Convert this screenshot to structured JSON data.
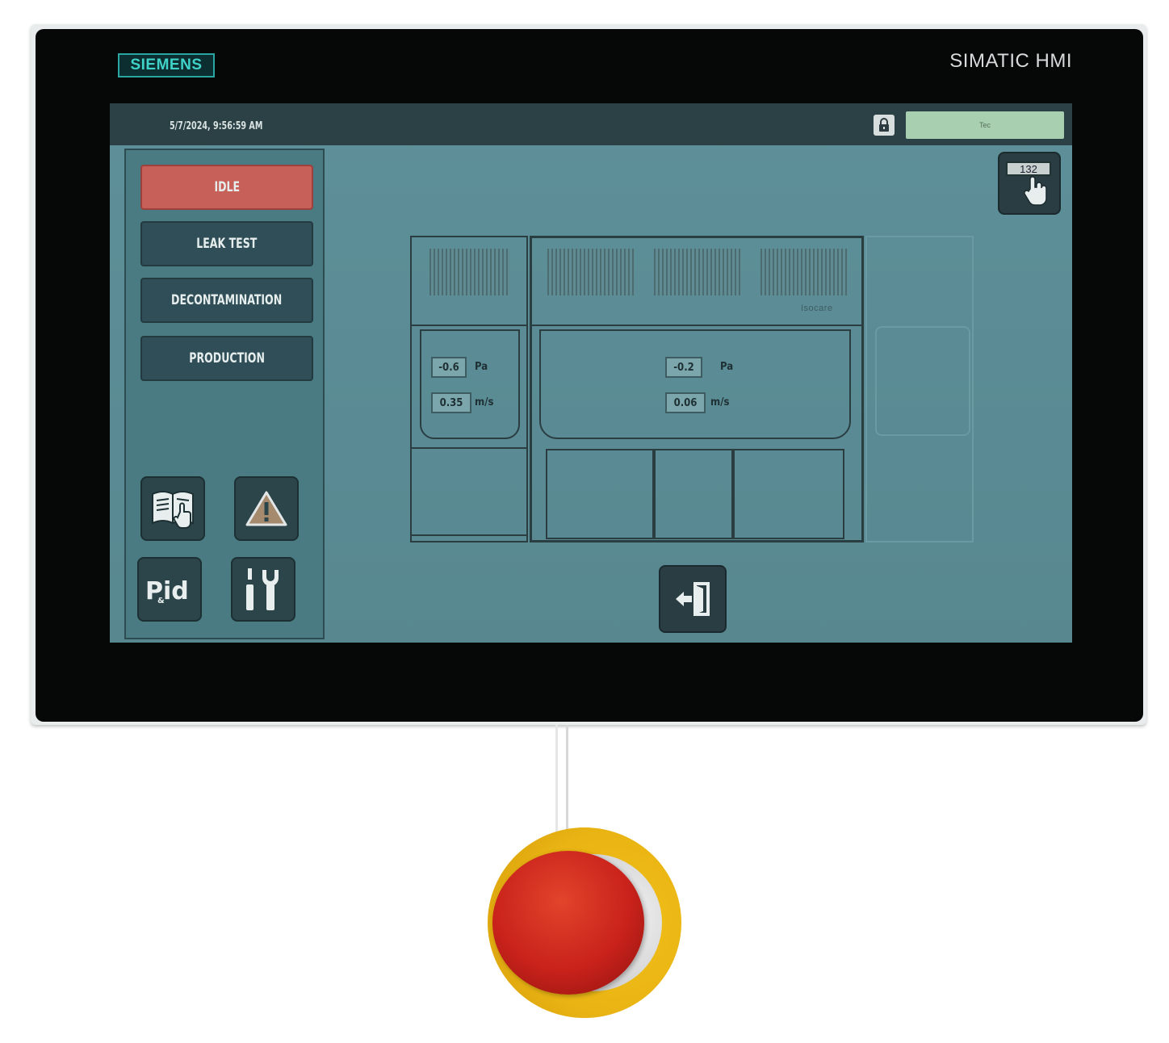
{
  "device": {
    "brand": "SIEMENS",
    "model": "SIMATIC HMI"
  },
  "topbar": {
    "datetime": "5/7/2024, 9:56:59 AM",
    "user": "Tec"
  },
  "sidebar": {
    "modes": [
      {
        "label": "IDLE",
        "active": true
      },
      {
        "label": "LEAK TEST",
        "active": false
      },
      {
        "label": "DECONTAMINATION",
        "active": false
      },
      {
        "label": "PRODUCTION",
        "active": false
      }
    ],
    "tools": [
      "manual-icon",
      "warning-icon",
      "pid-icon",
      "tools-icon"
    ],
    "pid_label": "Pid",
    "pid_sub": "&"
  },
  "keypad": {
    "display": "132"
  },
  "diagram": {
    "brand_mark": "Isocare",
    "left_chamber": {
      "pressure": "-0.6",
      "pressure_unit": "Pa",
      "airflow": "0.35",
      "airflow_unit": "m/s"
    },
    "main_chamber": {
      "pressure": "-0.2",
      "pressure_unit": "Pa",
      "airflow": "0.06",
      "airflow_unit": "m/s"
    }
  },
  "colors": {
    "screen_bg": "#5b8c95",
    "active_mode": "#c8605a",
    "mode_bg": "#2f4e57",
    "user_field": "#a8cfb0",
    "estop_red": "#c9221b",
    "estop_yellow": "#eab514"
  }
}
